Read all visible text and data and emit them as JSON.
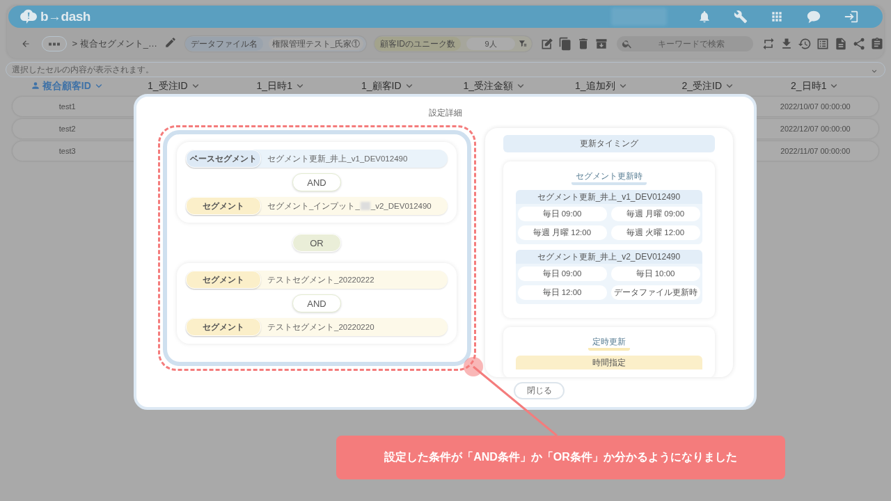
{
  "header": {
    "logo": "b→dash"
  },
  "toolbar": {
    "breadcrumb": "> 複合セグメント_…",
    "data_file": {
      "label": "データファイル名",
      "value": "権限管理テスト_氏家①"
    },
    "unique_count": {
      "label": "顧客IDのユニーク数",
      "value": "9人"
    },
    "search": {
      "placeholder": "キーワードで検索"
    }
  },
  "cell_bar": {
    "placeholder": "選択したセルの内容が表示されます。"
  },
  "table": {
    "columns": [
      {
        "label": "複合顧客ID",
        "kind": "key"
      },
      {
        "label": "1_受注ID",
        "kind": "plain"
      },
      {
        "label": "1_日時1",
        "kind": "plain"
      },
      {
        "label": "1_顧客ID",
        "kind": "plain"
      },
      {
        "label": "1_受注金額",
        "kind": "plain"
      },
      {
        "label": "1_追加列",
        "kind": "plain"
      },
      {
        "label": "2_受注ID",
        "kind": "plain"
      },
      {
        "label": "2_日時1",
        "kind": "plain"
      }
    ],
    "rows": [
      {
        "column_1": "test1",
        "column_8": "2022/10/07 00:00:00"
      },
      {
        "column_1": "test2",
        "column_8": "2022/12/07 00:00:00"
      },
      {
        "column_1": "test3",
        "column_8": "2022/11/07 00:00:00"
      }
    ]
  },
  "dialog": {
    "title": "設定詳細",
    "groups": [
      {
        "items": [
          {
            "kind": "base",
            "label": "ベースセグメント",
            "value": "セグメント更新_井上_v1_DEV012490"
          },
          {
            "kind": "segment",
            "label": "セグメント",
            "value": "セグメント_インプット_",
            "value_after_redaction": "_v2_DEV012490"
          }
        ],
        "joins": [
          "AND"
        ]
      },
      {
        "items": [
          {
            "kind": "segment",
            "label": "セグメント",
            "value": "テストセグメント_20220222"
          },
          {
            "kind": "segment",
            "label": "セグメント",
            "value": "テストセグメント_20220220"
          }
        ],
        "joins": [
          "AND"
        ]
      }
    ],
    "group_joins": [
      "OR"
    ],
    "timing": {
      "title": "更新タイミング",
      "sections": [
        {
          "kind": "segment",
          "title": "セグメント更新時",
          "blocks": [
            {
              "name": "セグメント更新_井上_v1_DEV012490",
              "schedules": [
                "毎日 09:00",
                "毎週 月曜 09:00",
                "毎週 月曜 12:00",
                "毎週 火曜 12:00"
              ]
            },
            {
              "name": "セグメント更新_井上_v2_DEV012490",
              "schedules": [
                "毎日 09:00",
                "毎日 10:00",
                "毎日 12:00",
                "データファイル更新時"
              ]
            }
          ]
        },
        {
          "kind": "fixed",
          "title": "定時更新",
          "blocks": [
            {
              "name": "時間指定"
            }
          ]
        }
      ]
    },
    "close": "閉じる"
  },
  "callout": {
    "text": "設定した条件が「AND条件」か「OR条件」か分かるようになりました"
  }
}
